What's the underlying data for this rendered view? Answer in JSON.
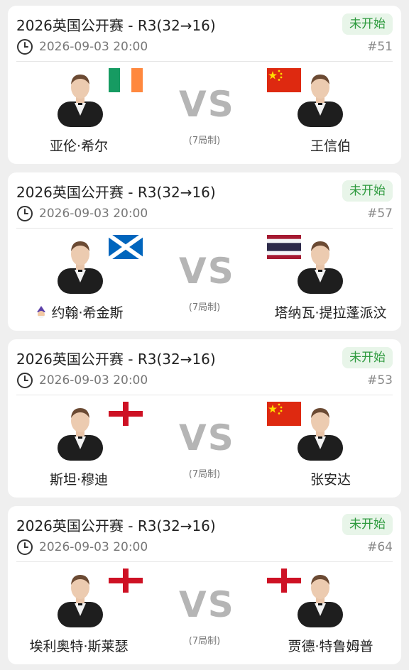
{
  "matches": [
    {
      "title": "2026英国公开赛 - R3(32→16)",
      "status": "未开始",
      "time": "2026-09-03 20:00",
      "number": "#51",
      "vs": "VS",
      "format": "(7局制)",
      "left": {
        "name": "亚伦·希尔",
        "flag": "ireland"
      },
      "right": {
        "name": "王信伯",
        "flag": "china"
      }
    },
    {
      "title": "2026英国公开赛 - R3(32→16)",
      "status": "未开始",
      "time": "2026-09-03 20:00",
      "number": "#57",
      "vs": "VS",
      "format": "(7局制)",
      "left": {
        "name": "约翰·希金斯",
        "flag": "scotland"
      },
      "right": {
        "name": "塔纳瓦·提拉蓬派汶",
        "flag": "thailand"
      }
    },
    {
      "title": "2026英国公开赛 - R3(32→16)",
      "status": "未开始",
      "time": "2026-09-03 20:00",
      "number": "#53",
      "vs": "VS",
      "format": "(7局制)",
      "left": {
        "name": "斯坦·穆迪",
        "flag": "england"
      },
      "right": {
        "name": "张安达",
        "flag": "china"
      }
    },
    {
      "title": "2026英国公开赛 - R3(32→16)",
      "status": "未开始",
      "time": "2026-09-03 20:00",
      "number": "#64",
      "vs": "VS",
      "format": "(7局制)",
      "left": {
        "name": "埃利奥特·斯莱瑟",
        "flag": "england"
      },
      "right": {
        "name": "贾德·特鲁姆普",
        "flag": "england"
      }
    }
  ],
  "colors": {
    "status_bg": "#e8f5e9",
    "status_text": "#2e9a3e",
    "vs": "#b5b5b5"
  }
}
